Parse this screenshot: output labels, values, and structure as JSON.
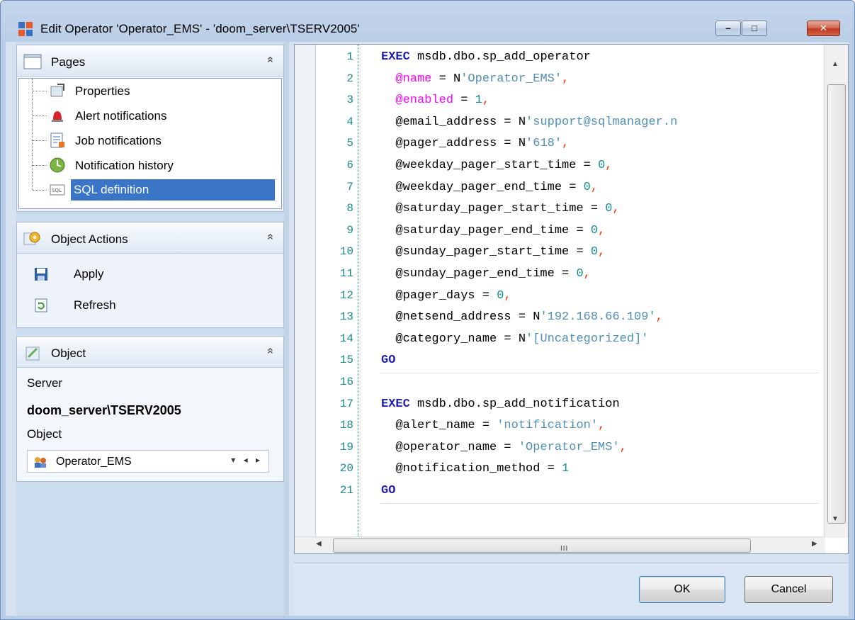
{
  "window": {
    "title": "Edit Operator 'Operator_EMS' - 'doom_server\\TSERV2005'",
    "controls": {
      "minimize": "–",
      "maximize": "□",
      "close": "✕"
    }
  },
  "pages": {
    "header": "Pages",
    "collapse_glyph": "»",
    "items": [
      {
        "label": "Properties",
        "icon": "properties-icon"
      },
      {
        "label": "Alert notifications",
        "icon": "alert-icon"
      },
      {
        "label": "Job notifications",
        "icon": "job-icon"
      },
      {
        "label": "Notification history",
        "icon": "history-icon"
      },
      {
        "label": "SQL definition",
        "icon": "sql-icon",
        "selected": true
      }
    ]
  },
  "object_actions": {
    "header": "Object Actions",
    "collapse_glyph": "»",
    "items": [
      {
        "label": "Apply",
        "icon": "save-icon"
      },
      {
        "label": "Refresh",
        "icon": "refresh-icon"
      }
    ]
  },
  "object": {
    "header": "Object",
    "collapse_glyph": "»",
    "server_label": "Server",
    "server_value": "doom_server\\TSERV2005",
    "object_label": "Object",
    "object_value": "Operator_EMS",
    "select_controls": "▾ ◂ ▸"
  },
  "editor": {
    "line_numbers": [
      "1",
      "2",
      "3",
      "4",
      "5",
      "6",
      "7",
      "8",
      "9",
      "10",
      "11",
      "12",
      "13",
      "14",
      "15",
      "16",
      "17",
      "18",
      "19",
      "20",
      "21"
    ],
    "hscroll_grip": "III",
    "scroll_up": "▲",
    "scroll_down": "▼",
    "scroll_left": "◀",
    "scroll_right": "▶",
    "lines": [
      [
        {
          "t": "EXEC",
          "c": "kw"
        },
        {
          "t": " msdb.dbo.sp_add_operator",
          "c": ""
        }
      ],
      [
        {
          "t": "  ",
          "c": ""
        },
        {
          "t": "@name",
          "c": "par"
        },
        {
          "t": " = N",
          "c": ""
        },
        {
          "t": "'Operator_EMS'",
          "c": "str"
        },
        {
          "t": ",",
          "c": "pct"
        }
      ],
      [
        {
          "t": "  ",
          "c": ""
        },
        {
          "t": "@enabled",
          "c": "par"
        },
        {
          "t": " = ",
          "c": ""
        },
        {
          "t": "1",
          "c": "num"
        },
        {
          "t": ",",
          "c": "pct"
        }
      ],
      [
        {
          "t": "  @email_address = N",
          "c": ""
        },
        {
          "t": "'support@sqlmanager.n",
          "c": "str"
        }
      ],
      [
        {
          "t": "  @pager_address = N",
          "c": ""
        },
        {
          "t": "'618'",
          "c": "str"
        },
        {
          "t": ",",
          "c": "pct"
        }
      ],
      [
        {
          "t": "  @weekday_pager_start_time = ",
          "c": ""
        },
        {
          "t": "0",
          "c": "num"
        },
        {
          "t": ",",
          "c": "pct"
        }
      ],
      [
        {
          "t": "  @weekday_pager_end_time = ",
          "c": ""
        },
        {
          "t": "0",
          "c": "num"
        },
        {
          "t": ",",
          "c": "pct"
        }
      ],
      [
        {
          "t": "  @saturday_pager_start_time = ",
          "c": ""
        },
        {
          "t": "0",
          "c": "num"
        },
        {
          "t": ",",
          "c": "pct"
        }
      ],
      [
        {
          "t": "  @saturday_pager_end_time = ",
          "c": ""
        },
        {
          "t": "0",
          "c": "num"
        },
        {
          "t": ",",
          "c": "pct"
        }
      ],
      [
        {
          "t": "  @sunday_pager_start_time = ",
          "c": ""
        },
        {
          "t": "0",
          "c": "num"
        },
        {
          "t": ",",
          "c": "pct"
        }
      ],
      [
        {
          "t": "  @sunday_pager_end_time = ",
          "c": ""
        },
        {
          "t": "0",
          "c": "num"
        },
        {
          "t": ",",
          "c": "pct"
        }
      ],
      [
        {
          "t": "  @pager_days = ",
          "c": ""
        },
        {
          "t": "0",
          "c": "num"
        },
        {
          "t": ",",
          "c": "pct"
        }
      ],
      [
        {
          "t": "  @netsend_address = N",
          "c": ""
        },
        {
          "t": "'192.168.66.109'",
          "c": "str"
        },
        {
          "t": ",",
          "c": "pct"
        }
      ],
      [
        {
          "t": "  @category_name = N",
          "c": ""
        },
        {
          "t": "'[Uncategorized]'",
          "c": "str"
        }
      ],
      [
        {
          "t": "GO",
          "c": "kw"
        }
      ],
      [],
      [
        {
          "t": "EXEC",
          "c": "kw"
        },
        {
          "t": " msdb.dbo.sp_add_notification",
          "c": ""
        }
      ],
      [
        {
          "t": "  @alert_name = ",
          "c": ""
        },
        {
          "t": "'notification'",
          "c": "str"
        },
        {
          "t": ",",
          "c": "pct"
        }
      ],
      [
        {
          "t": "  @operator_name = ",
          "c": ""
        },
        {
          "t": "'Operator_EMS'",
          "c": "str"
        },
        {
          "t": ",",
          "c": "pct"
        }
      ],
      [
        {
          "t": "  @notification_method = ",
          "c": ""
        },
        {
          "t": "1",
          "c": "num"
        }
      ],
      [
        {
          "t": "GO",
          "c": "kw"
        }
      ]
    ]
  },
  "buttons": {
    "ok": "OK",
    "cancel": "Cancel"
  }
}
